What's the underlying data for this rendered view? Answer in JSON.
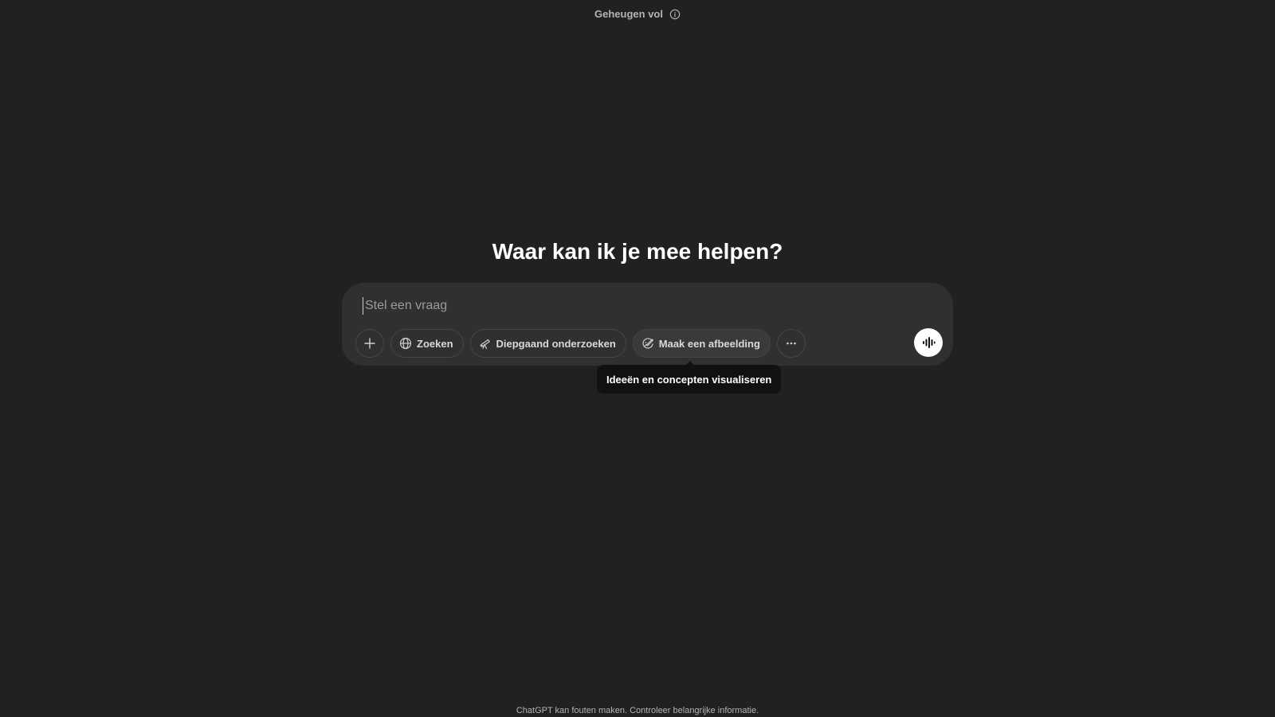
{
  "header": {
    "memory_status": "Geheugen vol"
  },
  "main": {
    "heading": "Waar kan ik je mee helpen?"
  },
  "composer": {
    "placeholder": "Stel een vraag",
    "value": "",
    "tools": {
      "search_label": "Zoeken",
      "deep_research_label": "Diepgaand onderzoeken",
      "create_image_label": "Maak een afbeelding"
    }
  },
  "tooltip": {
    "text": "Ideeën en concepten visualiseren"
  },
  "footer": {
    "disclaimer": "ChatGPT kan fouten maken. Controleer belangrijke informatie."
  },
  "icons": {
    "memory_info": "info-icon",
    "add": "plus-icon",
    "search": "globe-icon",
    "deep_research": "telescope-icon",
    "create_image": "image-brush-icon",
    "more": "ellipsis-icon",
    "voice": "voice-waveform-icon"
  },
  "colors": {
    "background": "#212121",
    "composer": "#303030",
    "voice_button": "#ffffff",
    "tooltip": "#111111"
  }
}
